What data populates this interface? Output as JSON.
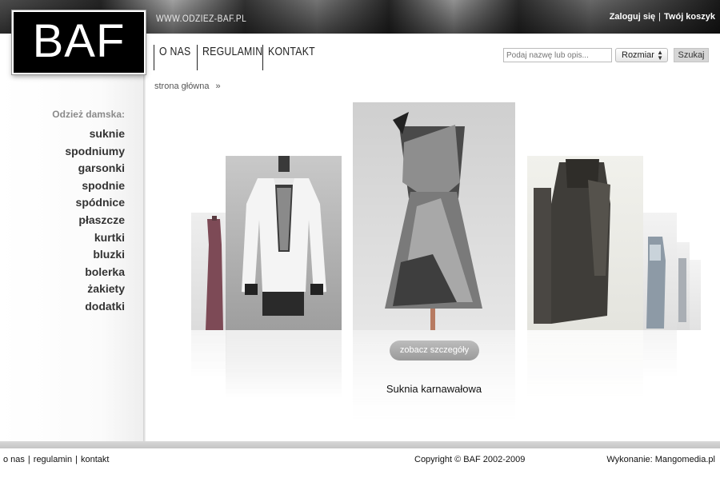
{
  "header": {
    "site_url": "WWW.ODZIEZ-BAF.PL",
    "login": "Zaloguj się",
    "separator": "|",
    "cart": "Twój koszyk"
  },
  "logo": {
    "text": "BAF"
  },
  "nav": {
    "items": [
      "O NAS",
      "REGULAMIN",
      "KONTAKT"
    ]
  },
  "search": {
    "placeholder": "Podaj nazwę lub opis...",
    "size_label": "Rozmiar",
    "button": "Szukaj"
  },
  "breadcrumb": {
    "home": "strona główna",
    "separator": "»"
  },
  "sidebar": {
    "title": "Odzież damska:",
    "categories": [
      "suknie",
      "spodniumy",
      "garsonki",
      "spodnie",
      "spódnice",
      "płaszcze",
      "kurtki",
      "bluzki",
      "bolerka",
      "żakiety",
      "dodatki"
    ]
  },
  "carousel": {
    "details_button": "zobacz szczegóły",
    "product_name": "Suknia karnawałowa"
  },
  "footer": {
    "links": [
      "o nas",
      "regulamin",
      "kontakt"
    ],
    "separator": "|",
    "copyright": "Copyright © BAF 2002-2009",
    "credit": "Wykonanie: Mangomedia.pl"
  },
  "colors": {
    "topbar": "#2a2a2a",
    "logo_bg": "#000000",
    "text": "#333333",
    "muted": "#8a8a8a",
    "button": "#d6d6d6"
  }
}
